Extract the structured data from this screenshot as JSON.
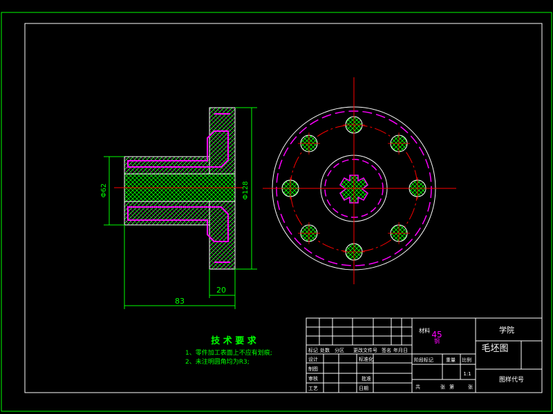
{
  "colors": {
    "background": "#000000",
    "frame": "#00ff00",
    "outline": "#ffffff",
    "centerline": "#ff0000",
    "hidden_line": "#ff00ff",
    "hatch": "#00ff00",
    "dimension": "#00ff00",
    "text": "#00ff00",
    "title_text": "#ffffff"
  },
  "dimensions": {
    "diameter_small": "Φ62",
    "diameter_large": "Φ128",
    "flange_width": "20",
    "total_length": "83"
  },
  "technical_requirements": {
    "heading": "技 术 要 求",
    "items": [
      "1、零件加工表面上不应有划痕;",
      "2、未注明圆角均为R3;"
    ]
  },
  "title_block": {
    "material_label": "材料",
    "material_value": "45",
    "material_sub": "钢",
    "school": "学院",
    "drawing_name": "毛坯图",
    "drawing_code": "图样代号",
    "scale": "1:1",
    "row_labels": [
      "设计",
      "制图",
      "审核",
      "工艺"
    ],
    "header_cells": [
      "标记",
      "处数",
      "分区",
      "更改文件号",
      "签名",
      "年月日"
    ],
    "mid_labels": [
      "标准化",
      "批准",
      "日期"
    ],
    "stage_cells": [
      "阶段标记",
      "重量",
      "比例"
    ],
    "sheet_cells": [
      "共",
      "张",
      "第",
      "张"
    ]
  }
}
